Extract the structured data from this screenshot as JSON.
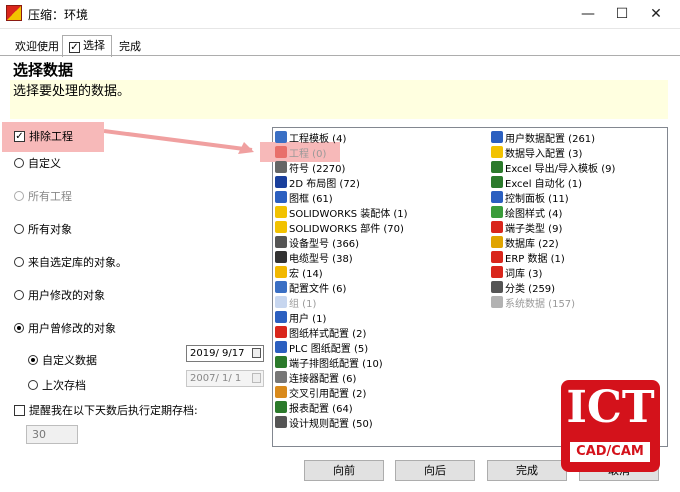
{
  "window": {
    "title": "压缩：环境",
    "minimize": "—",
    "maximize": "☐",
    "close": "✕"
  },
  "tabs": [
    {
      "label": "欢迎使用"
    },
    {
      "label": "选择"
    },
    {
      "label": "完成"
    }
  ],
  "header": {
    "title": "选择数据",
    "description": "选择要处理的数据。"
  },
  "options": {
    "exclude_projects": "排除工程",
    "custom": "自定义",
    "all_projects": "所有工程",
    "all_objects": "所有对象",
    "from_library": "来自选定库的对象。",
    "user_modified": "用户修改的对象",
    "user_ever_modified": "用户曾修改的对象",
    "custom_data": "自定义数据",
    "last_archive": "上次存档",
    "remind": "提醒我在以下天数后执行定期存档:",
    "date1": "2019/ 9/17",
    "date2": "2007/ 1/ 1",
    "days": "30"
  },
  "list_left": [
    {
      "label": "工程模板 (4)",
      "icon": "template-icon",
      "color": "#3a6fc4"
    },
    {
      "label": "工程 (0)",
      "icon": "project-icon",
      "color": "#d9261c",
      "dim": true
    },
    {
      "label": "符号 (2270)",
      "icon": "symbol-icon",
      "color": "#666666"
    },
    {
      "label": "2D 布局图 (72)",
      "icon": "layout-icon",
      "color": "#1a3f9c"
    },
    {
      "label": "图框 (61)",
      "icon": "frame-icon",
      "color": "#2b5fc0"
    },
    {
      "label": "SOLIDWORKS 装配体 (1)",
      "icon": "assembly-icon",
      "color": "#f2c200"
    },
    {
      "label": "SOLIDWORKS 部件 (70)",
      "icon": "part-icon",
      "color": "#f2c200"
    },
    {
      "label": "设备型号 (366)",
      "icon": "device-icon",
      "color": "#555555"
    },
    {
      "label": "电缆型号 (38)",
      "icon": "cable-icon",
      "color": "#333333"
    },
    {
      "label": "宏 (14)",
      "icon": "macro-icon",
      "color": "#f2b800"
    },
    {
      "label": "配置文件 (6)",
      "icon": "config-icon",
      "color": "#3a6fc4"
    },
    {
      "label": "组 (1)",
      "icon": "group-icon",
      "color": "#8faee0",
      "dim": true
    },
    {
      "label": "用户 (1)",
      "icon": "user-icon",
      "color": "#2b5fc0"
    },
    {
      "label": "图纸样式配置 (2)",
      "icon": "sheet-style-icon",
      "color": "#d9261c"
    },
    {
      "label": "PLC 图纸配置 (5)",
      "icon": "plc-icon",
      "color": "#2b5fc0"
    },
    {
      "label": "端子排图纸配置 (10)",
      "icon": "terminal-icon",
      "color": "#2b7a2b"
    },
    {
      "label": "连接器配置 (6)",
      "icon": "connector-icon",
      "color": "#777777"
    },
    {
      "label": "交叉引用配置 (2)",
      "icon": "crossref-icon",
      "color": "#d98a1c"
    },
    {
      "label": "报表配置 (64)",
      "icon": "report-icon",
      "color": "#2b7a2b"
    },
    {
      "label": "设计规则配置 (50)",
      "icon": "rule-icon",
      "color": "#555555"
    }
  ],
  "list_right": [
    {
      "label": "用户数据配置 (261)",
      "icon": "user-data-icon",
      "color": "#2b5fc0"
    },
    {
      "label": "数据导入配置 (3)",
      "icon": "import-icon",
      "color": "#f2c200"
    },
    {
      "label": "Excel 导出/导入模板 (9)",
      "icon": "excel-template-icon",
      "color": "#2b7a2b"
    },
    {
      "label": "Excel 自动化 (1)",
      "icon": "excel-auto-icon",
      "color": "#2b7a2b"
    },
    {
      "label": "控制面板 (11)",
      "icon": "control-panel-icon",
      "color": "#2b5fc0"
    },
    {
      "label": "绘图样式 (4)",
      "icon": "drawing-style-icon",
      "color": "#3a9c3a"
    },
    {
      "label": "端子类型 (9)",
      "icon": "terminal-type-icon",
      "color": "#d9261c"
    },
    {
      "label": "数据库 (22)",
      "icon": "database-icon",
      "color": "#e0a400"
    },
    {
      "label": "ERP 数据 (1)",
      "icon": "erp-icon",
      "color": "#d9261c"
    },
    {
      "label": "词库 (3)",
      "icon": "dictionary-icon",
      "color": "#d9261c"
    },
    {
      "label": "分类 (259)",
      "icon": "classification-icon",
      "color": "#555555"
    },
    {
      "label": "系统数据 (157)",
      "icon": "system-data-icon",
      "color": "#666666",
      "dim": true
    }
  ],
  "buttons": {
    "back": "向前",
    "next": "向后",
    "finish": "完成",
    "cancel": "取消"
  },
  "logo": {
    "text": "ICT",
    "sub": "CAD/CAM"
  }
}
